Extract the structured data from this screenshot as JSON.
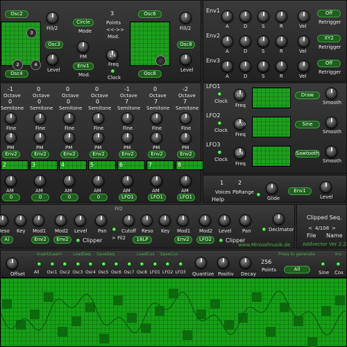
{
  "osc_section": {
    "left_top": "Osc2",
    "left_bottom": "Osc4",
    "left_mid": "Osc3",
    "fill_label": "Fill/2",
    "level_label": "Level",
    "mode_value": "Circle",
    "mode_label": "Mode",
    "points_value": "3",
    "points_label": "Points",
    "arrows": "<<->>",
    "mod_label": "Mod.",
    "fm_label": "FM",
    "env_value": "Env1",
    "mod2_label": "Mod.",
    "freq_value": "1/4",
    "freq_label": "Freq",
    "clock_label": "Clock",
    "right_top": "Osc6",
    "right_mid": "Osc8",
    "right_bottom": "Osc8",
    "right_fill_label": "Fill/2",
    "right_level_label": "Level",
    "screen_markers": [
      "3",
      "2",
      "4"
    ]
  },
  "envelopes": {
    "rows": [
      {
        "name": "Env1",
        "a": "A",
        "d": "D",
        "s": "S",
        "r": "R",
        "vel": "Vel",
        "mode": "Off",
        "mode_label": "Retrigger"
      },
      {
        "name": "Env2",
        "a": "A",
        "d": "D",
        "s": "S",
        "r": "R",
        "vel": "Vel",
        "mode": "XY2",
        "mode_label": "Retrigger"
      },
      {
        "name": "Env3",
        "a": "A",
        "d": "D",
        "s": "S",
        "r": "R",
        "vel": "Vel",
        "mode": "Off",
        "mode_label": "Retrigger"
      }
    ]
  },
  "lfos": {
    "rows": [
      {
        "name": "LFO1",
        "clock": "Clock",
        "freq_value": "1/1",
        "freq_label": "Freq",
        "shape": "Draw",
        "smooth": "Smooth"
      },
      {
        "name": "LFO2",
        "clock": "Clock",
        "freq_value": "0.10",
        "freq_label": "Freq",
        "shape": "Sine",
        "smooth": "Smooth"
      },
      {
        "name": "LFO3",
        "clock": "Clock",
        "freq_value": "1/8",
        "freq_label": "Freq",
        "shape": "Sawtooth",
        "smooth": "Smooth"
      }
    ]
  },
  "osc_columns": {
    "octave_label": "Octave",
    "semitone_label": "Semitone",
    "fine_label": "Fine",
    "pm_label": "PM",
    "am_label": "AM",
    "cols": [
      {
        "octave": "-1",
        "semitone": "0",
        "env": "Env2",
        "num": "2",
        "am_src": "0"
      },
      {
        "octave": "0",
        "semitone": "0",
        "env": "Env2",
        "num": "3",
        "am_src": "0"
      },
      {
        "octave": "0",
        "semitone": "0",
        "env": "Env2",
        "num": "4",
        "am_src": "0"
      },
      {
        "octave": "0",
        "semitone": "0",
        "env": "Env2",
        "num": "5",
        "am_src": "0"
      },
      {
        "octave": "-1",
        "semitone": "7",
        "env": "Env2",
        "num": "6",
        "am_src": "LFO1"
      },
      {
        "octave": "0",
        "semitone": "7",
        "env": "Env2",
        "num": "7",
        "am_src": "LFO1"
      },
      {
        "octave": "-2",
        "semitone": "7",
        "env": "Env2",
        "num": "8",
        "am_src": "LFO1"
      }
    ]
  },
  "voices": {
    "voices_value": "1",
    "voices_label": "Voices",
    "pb_value": "2",
    "pb_label": "PbRange",
    "help": "Help",
    "glide": "Glide",
    "env": "Env1",
    "level": "Level"
  },
  "filters": {
    "fil2_title": "Fil2",
    "f1_reso": "Reso",
    "f1_key": "Key",
    "f1_mod1": "Mod1",
    "f1_mod2": "Mod2",
    "f1_level": "Level",
    "f1_pan": "Pan",
    "f1_mode": "A)",
    "f1_env_a": "Env2",
    "f1_env_b": "Env2",
    "f1_clipper": "Clipper",
    "to_fil2": "> Fil2",
    "f2_cutoff": "Cutoff",
    "f2_reso": "Reso",
    "f2_key": "Key",
    "f2_mod1": "Mod1",
    "f2_mod2": "Mod2",
    "f2_level": "Level",
    "f2_pan": "Pan",
    "f2_mode": "18LP",
    "f2_env": "Env2",
    "f2_lfo": "LFO2",
    "f2_clipper": "Clipper",
    "decimator": "Decimator",
    "website": "www.Miniosfmusik.de"
  },
  "seq": {
    "title": "Clipped Seq.",
    "position": "4/108",
    "file": "File",
    "name": "Name",
    "version": "Addvector Ver 2.2",
    "offset": "Offset",
    "insert_label": "Insert/Learn",
    "load_seq": "LoadSeq",
    "save_seq": "SaveSeq",
    "load_cos": "LoadCos",
    "save_cos": "SaveCos",
    "press_generate": "Press to generate",
    "inv": "Inv",
    "src": [
      "All",
      "Osc1",
      "Osc2",
      "Osc3",
      "Osc4",
      "Osc5",
      "Osc6",
      "Osc7",
      "Osc8",
      "LFO1",
      "LFO2",
      "LFO3"
    ],
    "quantize": "Quantize",
    "positiv": "Positiv",
    "decay": "Decay",
    "points_value": "256",
    "points_label": "Points",
    "generate_value": "All",
    "sine": "Sine",
    "cos": "Cos"
  },
  "colors": {
    "accent_green": "#1ea01e",
    "pill_green": "#1f5e1f",
    "panel": "#2e2e2e"
  }
}
